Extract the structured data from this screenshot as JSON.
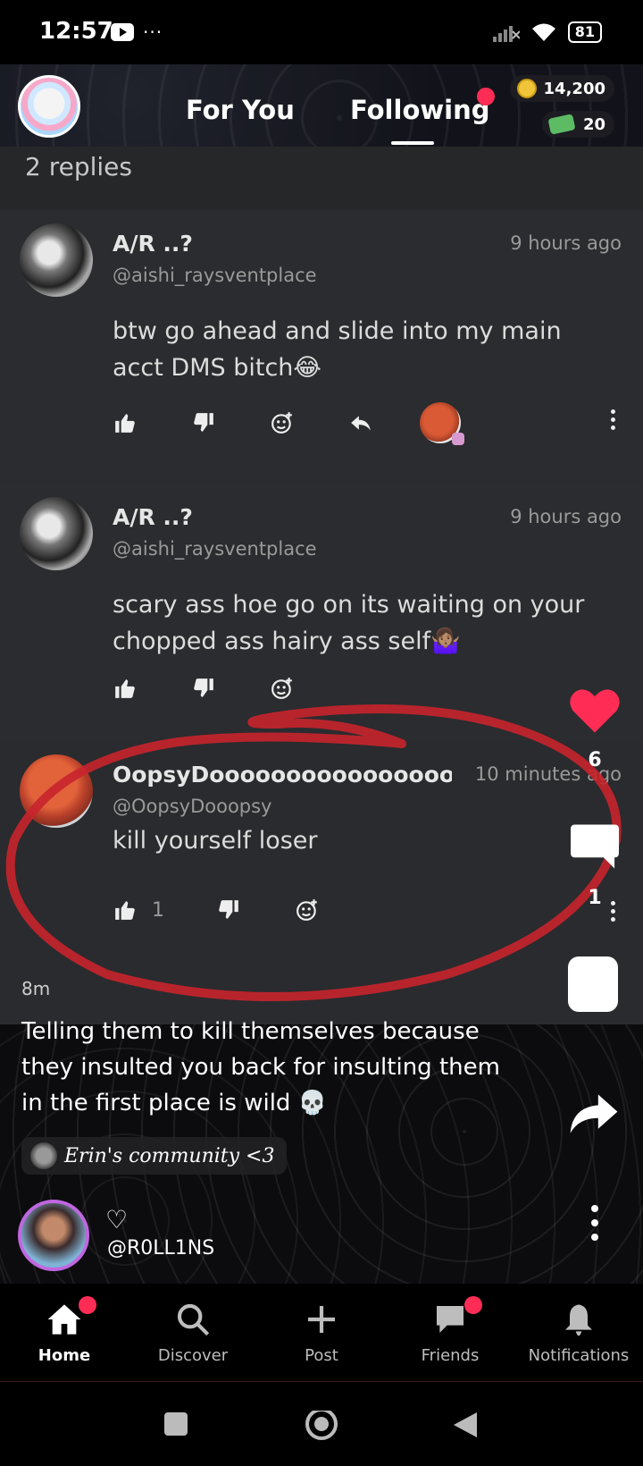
{
  "status_bar": {
    "time": "12:57",
    "dots": "···",
    "battery": "81"
  },
  "header": {
    "tabs": [
      {
        "label": "For You"
      },
      {
        "label": "Following"
      }
    ],
    "coins": "14,200",
    "cash": "20"
  },
  "sheet": {
    "replies_label": "2 replies",
    "comments": [
      {
        "name": "A/R ..?",
        "handle": "@aishi_raysventplace",
        "time": "9 hours ago",
        "text": "btw go ahead and slide into my main acct DMS bitch😂"
      },
      {
        "name": "A/R ..?",
        "handle": "@aishi_raysventplace",
        "time": "9 hours ago",
        "text": "scary ass hoe go on its waiting on your chopped ass hairy ass self🤷🏽‍♀️"
      },
      {
        "name": "OopsyDoooooooooooooooo",
        "handle": "@OopsyDooopsy",
        "time": "10 minutes ago",
        "text": "kill yourself loser",
        "likes": "1"
      }
    ]
  },
  "rail": {
    "likes": "6",
    "comments": "1"
  },
  "post": {
    "age": "8m",
    "caption": "Telling them to kill themselves because they insulted you back for insulting them in the first place is wild 💀",
    "community": "Erin's community <3",
    "heart": "♡",
    "handle": "@R0LL1NS"
  },
  "nav": {
    "items": [
      {
        "label": "Home"
      },
      {
        "label": "Discover"
      },
      {
        "label": "Post"
      },
      {
        "label": "Friends"
      },
      {
        "label": "Notifications"
      }
    ]
  },
  "colors": {
    "accent": "#ff2d55",
    "annotation": "#c8232c"
  }
}
